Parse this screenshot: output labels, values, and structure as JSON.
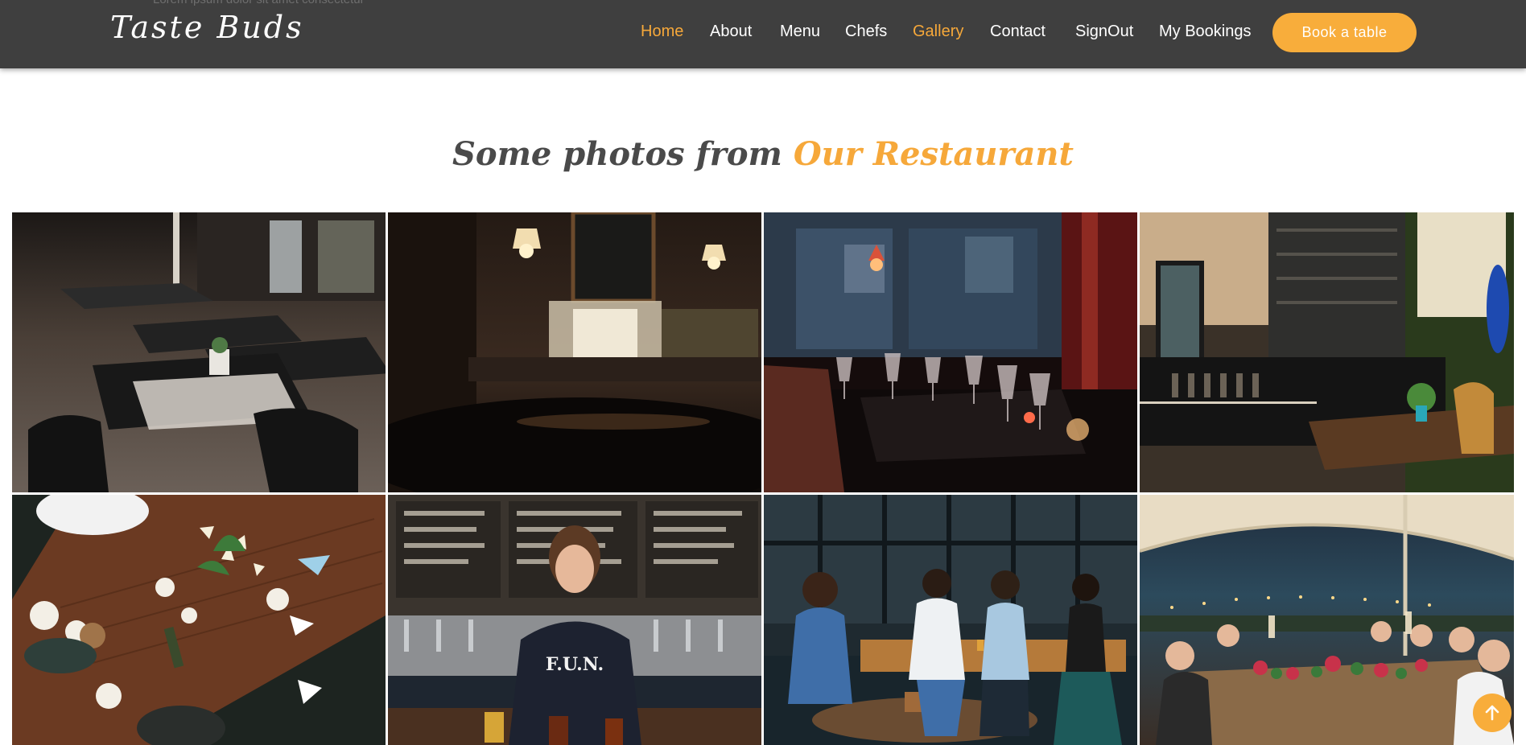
{
  "header": {
    "ghost_text": "Lorem ipsum dolor sit amet consectetur",
    "logo": "Taste Buds",
    "nav": [
      {
        "label": "Home",
        "active": true
      },
      {
        "label": "About",
        "active": false
      },
      {
        "label": "Menu",
        "active": false
      },
      {
        "label": "Chefs",
        "active": false
      },
      {
        "label": "Gallery",
        "active": true
      },
      {
        "label": "Contact",
        "active": false
      },
      {
        "label": "SignOut",
        "active": false
      },
      {
        "label": "My Bookings",
        "active": false
      }
    ],
    "book_button": "Book a table"
  },
  "gallery": {
    "title_prefix": "Some photos from ",
    "title_accent": "Our Restaurant",
    "photos": [
      {
        "name": "dining-tables-photo"
      },
      {
        "name": "pub-interior-photo"
      },
      {
        "name": "wine-glasses-photo"
      },
      {
        "name": "cafe-bar-photo"
      },
      {
        "name": "table-overhead-photo"
      },
      {
        "name": "bartender-photo",
        "shirt_text": "F.U.N."
      },
      {
        "name": "friends-patio-photo"
      },
      {
        "name": "outdoor-celebration-photo"
      }
    ]
  },
  "back_to_top": {
    "icon": "arrow-up-icon"
  },
  "colors": {
    "header_bg": "#3f3f3f",
    "accent": "#f6a83a",
    "button": "#f8ad3b",
    "title": "#4a4a4a"
  }
}
